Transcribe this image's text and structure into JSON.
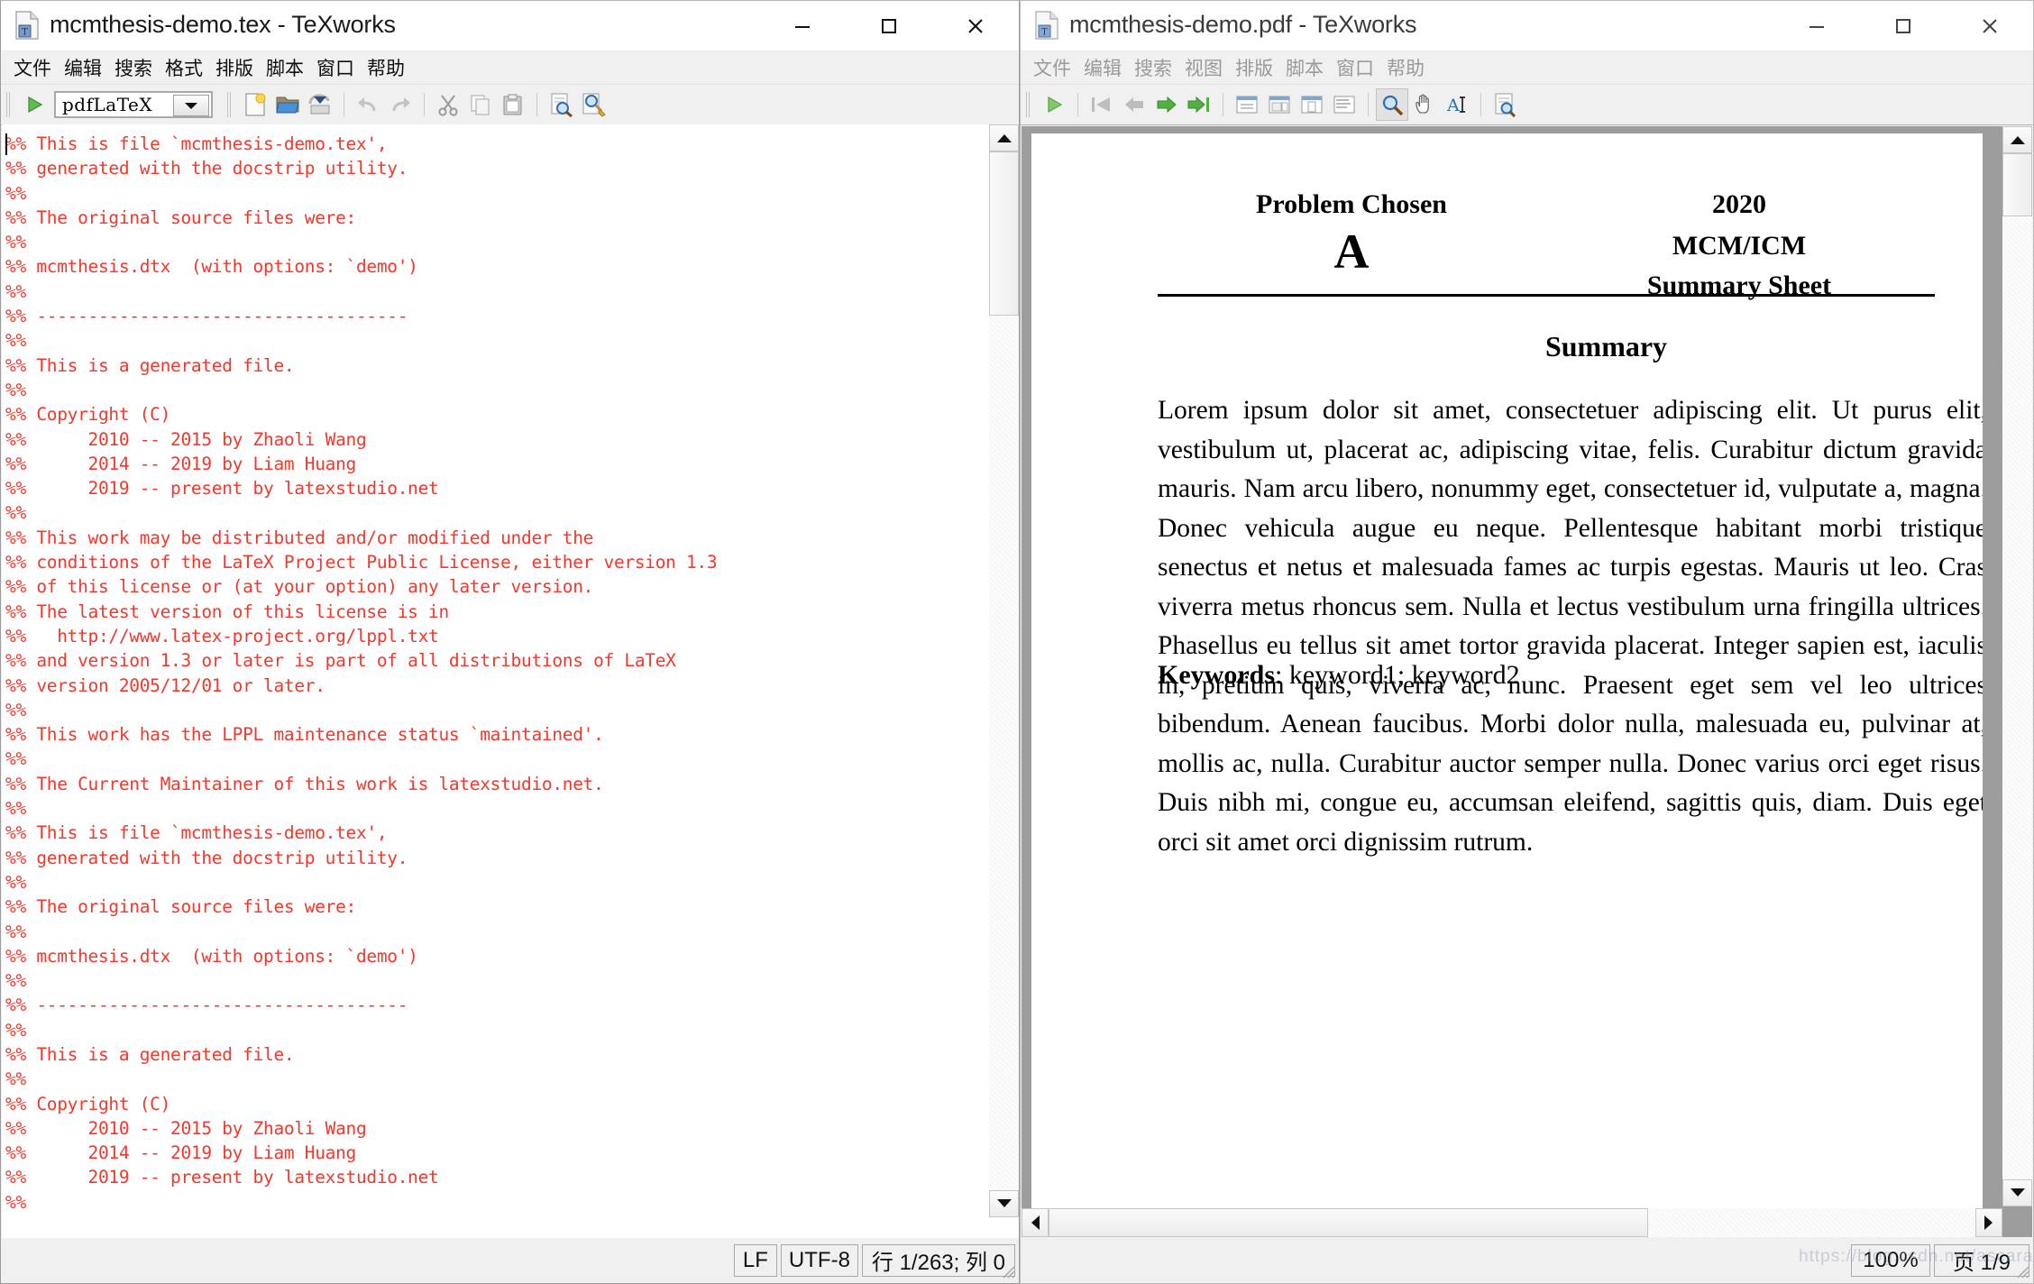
{
  "left_window": {
    "title": "mcmthesis-demo.tex - TeXworks",
    "icon": "tex-document-icon",
    "window_buttons": [
      {
        "name": "minimize",
        "glyph": "minimize-icon"
      },
      {
        "name": "maximize",
        "glyph": "maximize-icon"
      },
      {
        "name": "close",
        "glyph": "close-icon"
      }
    ],
    "menu": [
      "文件",
      "编辑",
      "搜索",
      "格式",
      "排版",
      "脚本",
      "帮助"
    ],
    "menu_full": [
      "文件",
      "编辑",
      "搜索",
      "格式",
      "排版",
      "脚本",
      "窗口",
      "帮助"
    ],
    "toolbar": {
      "typeset_button": "typeset-run-icon",
      "engine_combo_value": "pdfLaTeX",
      "buttons": [
        "new-document-icon",
        "open-file-icon",
        "save-file-icon",
        "undo-icon",
        "redo-icon",
        "cut-icon",
        "copy-icon",
        "paste-icon",
        "search-document-icon",
        "search-replace-icon"
      ]
    },
    "editor_text": "%% This is file `mcmthesis-demo.tex',\n%% generated with the docstrip utility.\n%%\n%% The original source files were:\n%%\n%% mcmthesis.dtx  (with options: `demo')\n%%\n%% ------------------------------------\n%%\n%% This is a generated file.\n%%\n%% Copyright (C)\n%%      2010 -- 2015 by Zhaoli Wang\n%%      2014 -- 2019 by Liam Huang\n%%      2019 -- present by latexstudio.net\n%%\n%% This work may be distributed and/or modified under the\n%% conditions of the LaTeX Project Public License, either version 1.3\n%% of this license or (at your option) any later version.\n%% The latest version of this license is in\n%%   http://www.latex-project.org/lppl.txt\n%% and version 1.3 or later is part of all distributions of LaTeX\n%% version 2005/12/01 or later.\n%%\n%% This work has the LPPL maintenance status `maintained'.\n%%\n%% The Current Maintainer of this work is latexstudio.net.\n%%\n%% This is file `mcmthesis-demo.tex',\n%% generated with the docstrip utility.\n%%\n%% The original source files were:\n%%\n%% mcmthesis.dtx  (with options: `demo')\n%%\n%% ------------------------------------\n%%\n%% This is a generated file.\n%%\n%% Copyright (C)\n%%      2010 -- 2015 by Zhaoli Wang\n%%      2014 -- 2019 by Liam Huang\n%%      2019 -- present by latexstudio.net\n%%",
    "statusbar": {
      "line_ending": "LF",
      "encoding": "UTF-8",
      "position": "行 1/263; 列 0"
    }
  },
  "right_window": {
    "title": "mcmthesis-demo.pdf - TeXworks",
    "icon": "tex-document-icon",
    "window_buttons": [
      {
        "name": "minimize",
        "glyph": "minimize-icon"
      },
      {
        "name": "maximize",
        "glyph": "maximize-icon"
      },
      {
        "name": "close",
        "glyph": "close-icon"
      }
    ],
    "menu": [
      "文件",
      "编辑",
      "搜索",
      "视图",
      "排版",
      "脚本",
      "窗口",
      "帮助"
    ],
    "toolbar": {
      "buttons": [
        "typeset-run-icon",
        "first-page-icon",
        "previous-page-icon",
        "next-page-icon",
        "last-page-icon",
        "fit-width-icon",
        "fit-window-icon",
        "actual-size-icon",
        "fit-content-icon",
        "magnifier-icon",
        "hand-pan-icon",
        "text-select-icon",
        "search-pdf-icon"
      ],
      "active_tool": "magnifier-icon"
    },
    "statusbar": {
      "zoom": "100%",
      "page": "页 1/9"
    }
  },
  "pdf": {
    "problem_chosen_label": "Problem Chosen",
    "problem_chosen_value": "A",
    "year": "2020",
    "contest": "MCM/ICM",
    "sheet": "Summary Sheet",
    "summary_heading": "Summary",
    "summary_text": "Lorem ipsum dolor sit amet, consectetuer adipiscing elit. Ut purus elit, vestibulum ut, placerat ac, adipiscing vitae, felis. Curabitur dictum gravida mauris. Nam arcu libero, nonummy eget, consectetuer id, vulputate a, magna. Donec vehicula augue eu neque. Pellentesque habitant morbi tristique senectus et netus et malesuada fames ac turpis egestas. Mauris ut leo. Cras viverra metus rhoncus sem. Nulla et lectus vestibulum urna fringilla ultrices. Phasellus eu tellus sit amet tortor gravida placerat. Integer sapien est, iaculis in, pretium quis, viverra ac, nunc. Praesent eget sem vel leo ultrices bibendum. Aenean faucibus. Morbi dolor nulla, malesuada eu, pulvinar at, mollis ac, nulla. Curabitur auctor semper nulla. Donec varius orci eget risus. Duis nibh mi, congue eu, accumsan eleifend, sagittis quis, diam. Duis eget orci sit amet orci dignissim rutrum.",
    "keywords_label": "Keywords",
    "keywords_value": "keyword1; keyword2"
  },
  "watermark": "https://blog.csdn.net/ascara"
}
